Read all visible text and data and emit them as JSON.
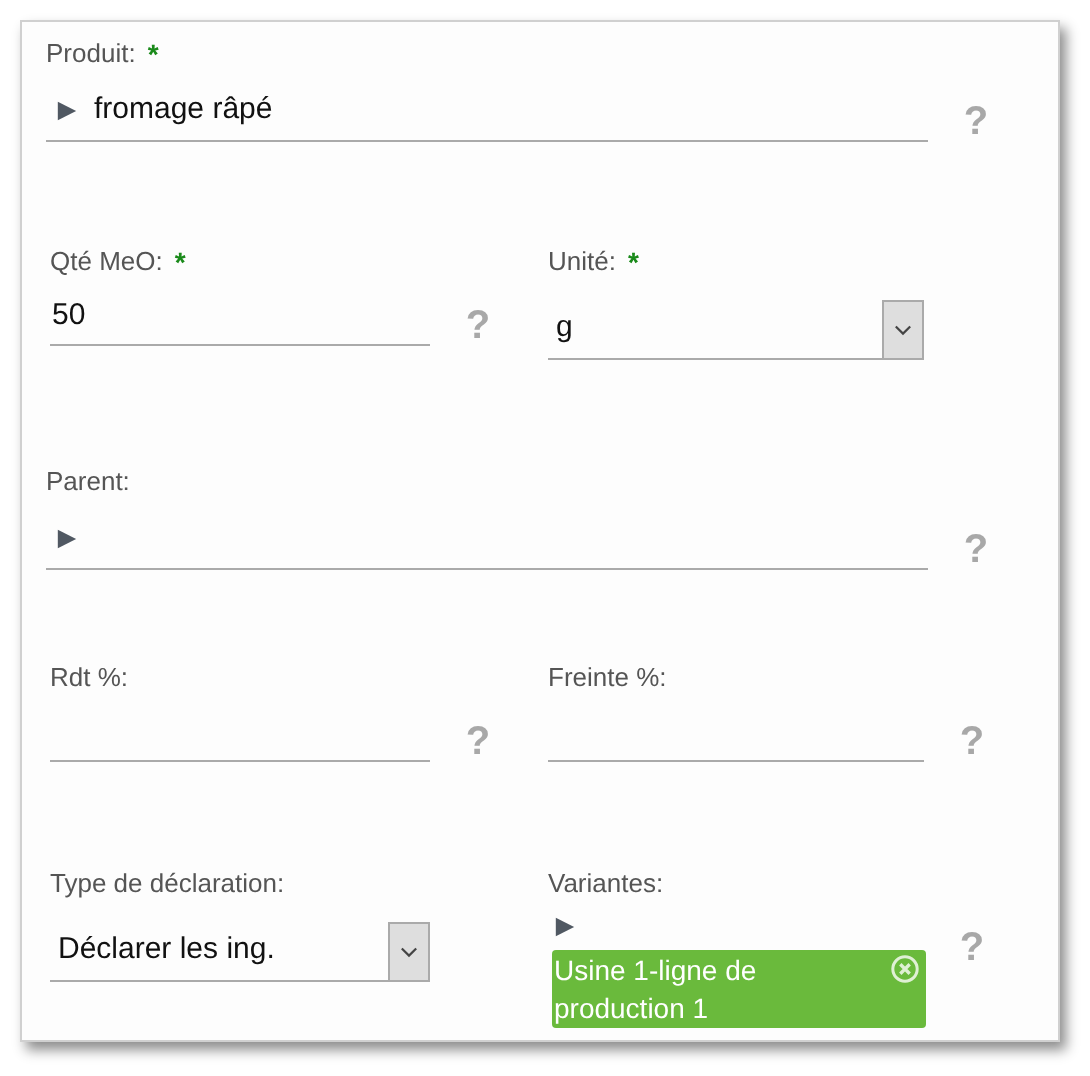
{
  "rows": [
    {
      "fields": [
        {
          "kind": "lookup",
          "label": "Produit:",
          "required_mark": "*",
          "value": "fromage râpé",
          "help": "?"
        }
      ]
    },
    {
      "fields": [
        {
          "kind": "text",
          "label": "Qté MeO:",
          "required_mark": "*",
          "value": "50",
          "help": "?"
        },
        {
          "kind": "select",
          "label": "Unité:",
          "required_mark": "*",
          "value": "g"
        }
      ]
    },
    {
      "fields": [
        {
          "kind": "lookup",
          "label": "Parent:",
          "help": "?"
        }
      ]
    },
    {
      "fields": [
        {
          "kind": "text",
          "label": "Rdt %:",
          "help": "?"
        },
        {
          "kind": "text",
          "label": "Freinte %:",
          "help": "?"
        }
      ]
    },
    {
      "fields": [
        {
          "kind": "select",
          "label": "Type de déclaration:",
          "value": "Déclarer les ing."
        },
        {
          "kind": "tags",
          "label": "Variantes:",
          "tags": [
            "Usine 1-ligne de production 1"
          ],
          "help": "?"
        }
      ]
    }
  ]
}
